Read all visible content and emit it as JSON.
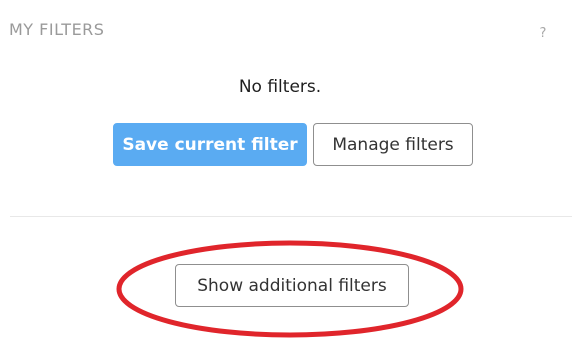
{
  "filters_panel": {
    "title": "MY FILTERS",
    "help_icon": "?",
    "empty_message": "No filters.",
    "save_button_label": "Save current filter",
    "manage_button_label": "Manage filters",
    "additional_button_label": "Show additional filters"
  },
  "colors": {
    "primary_button": "#5aabf2",
    "annotation_circle": "#e0252b"
  },
  "icons": {
    "help": "question-mark-icon"
  }
}
